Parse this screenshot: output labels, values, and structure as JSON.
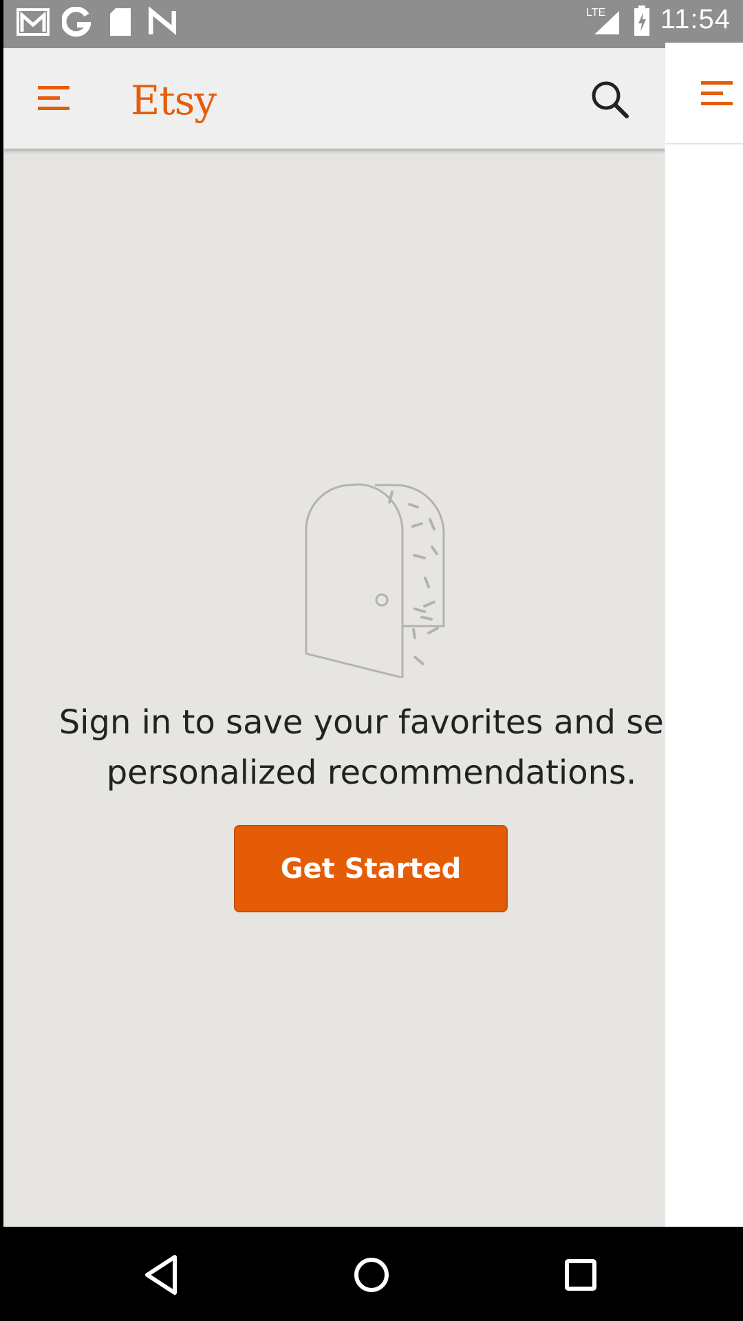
{
  "status_bar": {
    "time": "11:54",
    "network": "LTE",
    "icons": [
      "gmail-icon",
      "google-icon",
      "sd-card-icon",
      "n-icon",
      "signal-icon",
      "battery-charging-icon"
    ]
  },
  "toolbar": {
    "logo": "Etsy",
    "menu_icon": "hamburger-menu-icon",
    "search_icon": "search-icon"
  },
  "main": {
    "illustration": "open-door-icon",
    "message_line1": "Sign in to save your favorites and see",
    "message_line2": "personalized recommendations.",
    "button_label": "Get Started"
  },
  "colors": {
    "accent": "#e45d06",
    "background": "#e6e5e2",
    "toolbar": "#efefef"
  },
  "nav_bar": {
    "buttons": [
      "back-icon",
      "home-icon",
      "recents-icon"
    ]
  }
}
